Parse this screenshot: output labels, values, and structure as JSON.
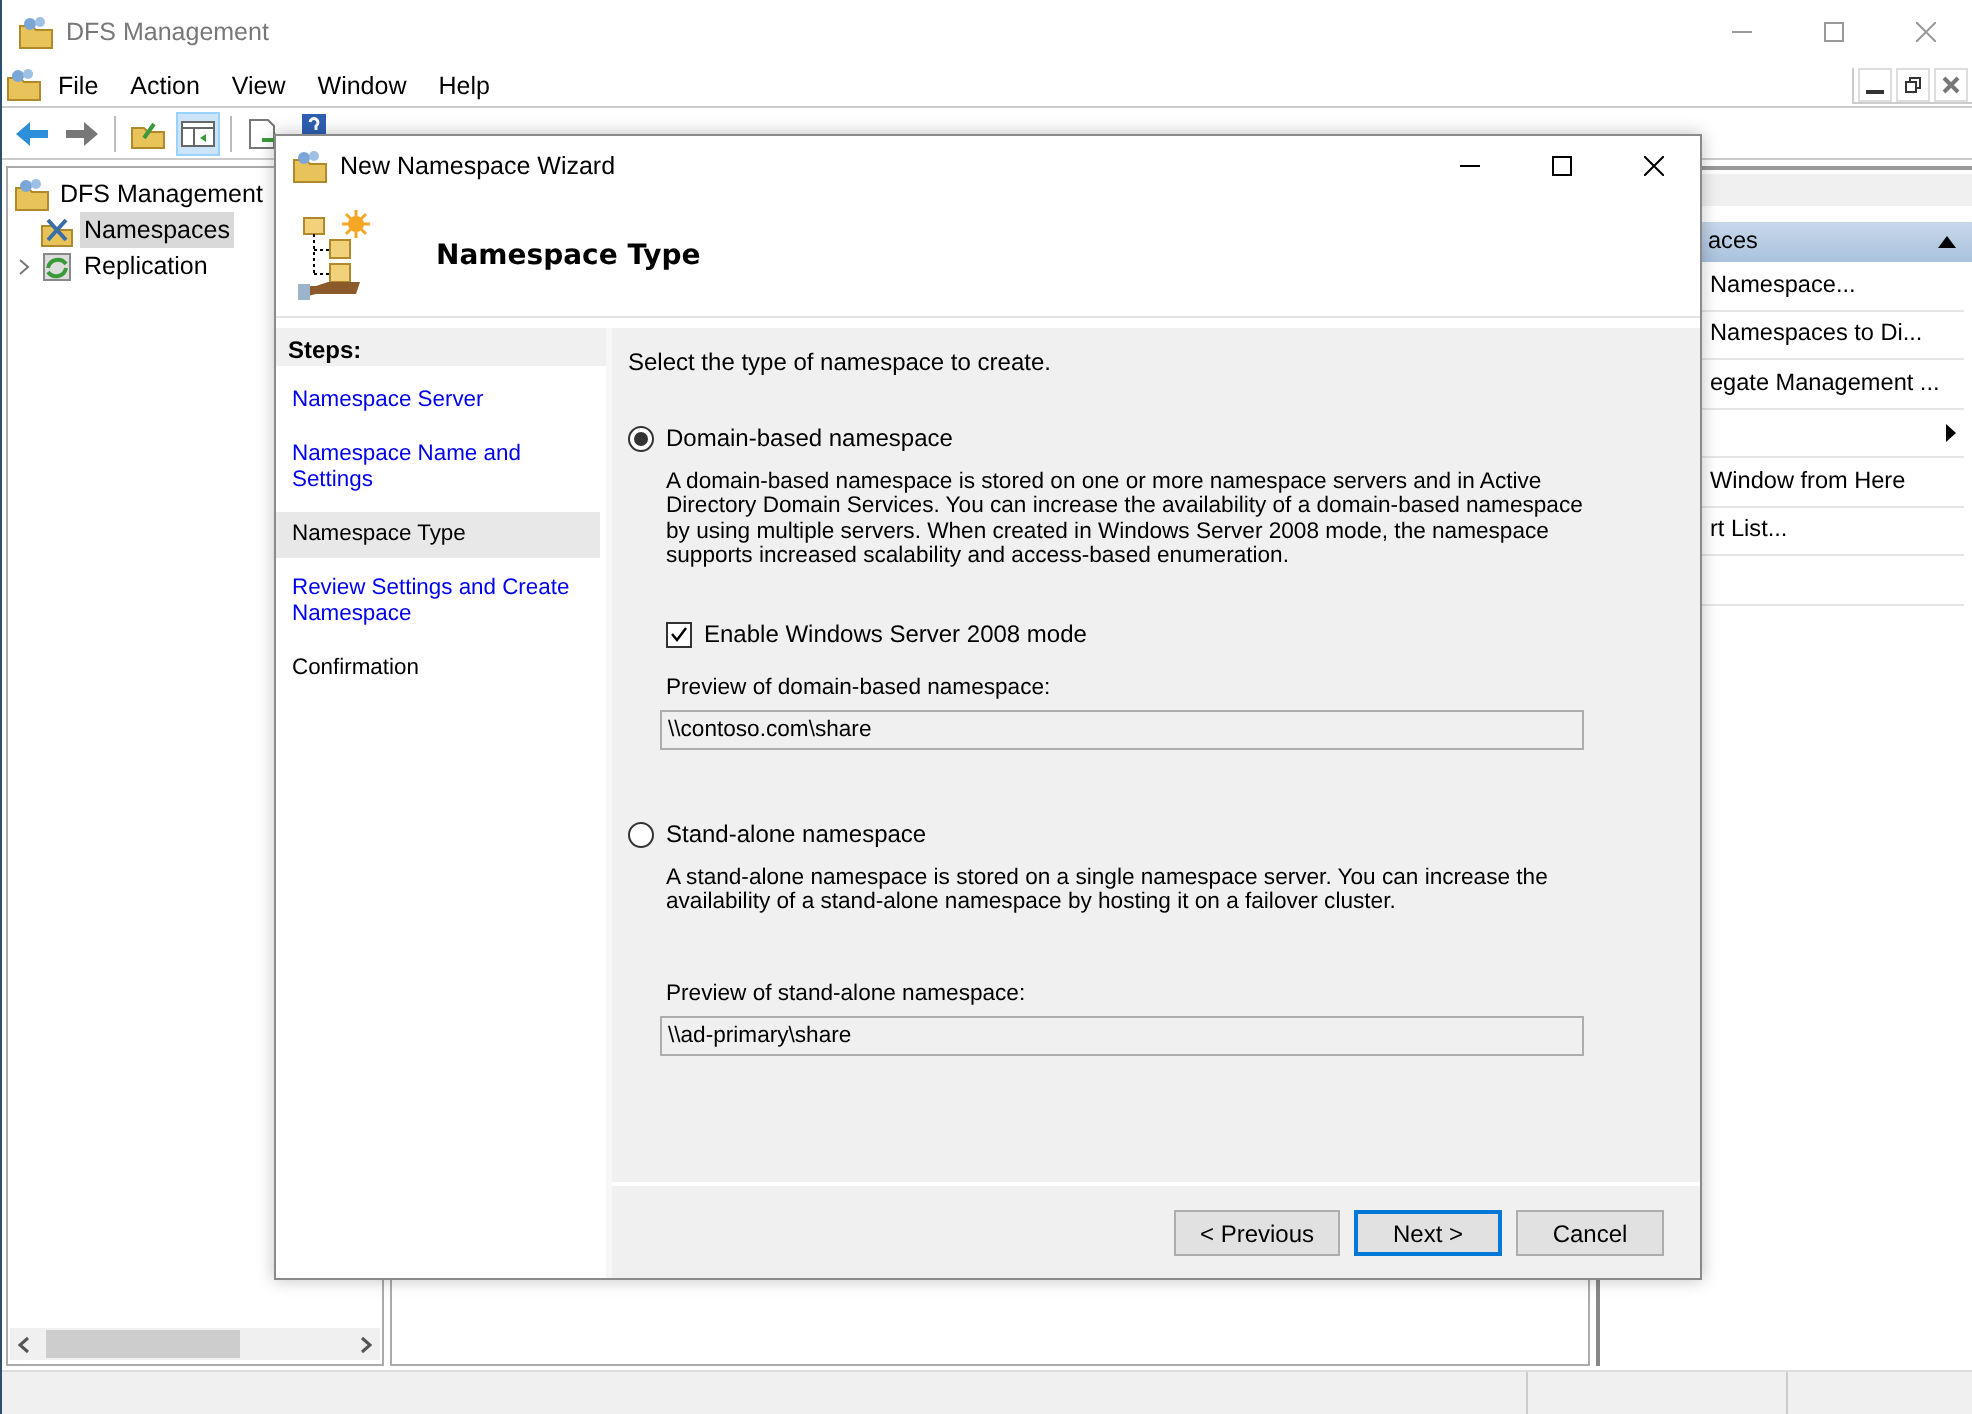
{
  "window": {
    "title": "DFS Management"
  },
  "menu": [
    "File",
    "Action",
    "View",
    "Window",
    "Help"
  ],
  "tree": [
    {
      "label": "DFS Management",
      "children": [
        {
          "label": "Namespaces",
          "selected": true,
          "collapsed": false
        },
        {
          "label": "Replication",
          "selected": false,
          "collapsed": true
        }
      ]
    }
  ],
  "actions": {
    "header": "aces",
    "items": [
      {
        "label": "Namespace...",
        "kind": "item"
      },
      {
        "label": "Namespaces to Di...",
        "kind": "item"
      },
      {
        "label": "egate Management ...",
        "kind": "item"
      },
      {
        "kind": "submenu"
      },
      {
        "label": "Window from Here",
        "kind": "item"
      },
      {
        "label": "rt List...",
        "kind": "item"
      },
      {
        "kind": "item"
      }
    ]
  },
  "wizard": {
    "title": "New Namespace Wizard",
    "heading": "Namespace Type",
    "steps_title": "Steps:",
    "steps": [
      {
        "label": "Namespace Server",
        "link": true,
        "selected": false
      },
      {
        "label": "Namespace Name and Settings",
        "link": true,
        "selected": false
      },
      {
        "label": "Namespace Type",
        "link": false,
        "selected": true
      },
      {
        "label": "Review Settings and Create Namespace",
        "link": true,
        "selected": false
      },
      {
        "label": "Confirmation",
        "link": false,
        "selected": false
      }
    ],
    "prompt": "Select the type of namespace to create.",
    "options": [
      {
        "label": "Domain-based namespace",
        "selected": true,
        "description": "A domain-based namespace is stored on one or more namespace servers and in Active Directory Domain Services. You can increase the availability of a domain-based namespace by using multiple servers. When created in Windows Server 2008 mode, the namespace supports increased scalability and access-based enumeration.",
        "checkbox": {
          "label": "Enable Windows Server 2008 mode",
          "checked": true
        },
        "preview_label": "Preview of domain-based namespace:",
        "preview_value": "\\\\contoso.com\\share"
      },
      {
        "label": "Stand-alone namespace",
        "selected": false,
        "description": "A stand-alone namespace is stored on a single namespace server. You can increase the availability of a stand-alone namespace by hosting it on a failover cluster.",
        "preview_label": "Preview of stand-alone namespace:",
        "preview_value": "\\\\ad-primary\\share"
      }
    ],
    "buttons": [
      {
        "label": "< Previous",
        "default": false
      },
      {
        "label": "Next >",
        "default": true
      },
      {
        "label": "Cancel",
        "default": false
      }
    ]
  }
}
